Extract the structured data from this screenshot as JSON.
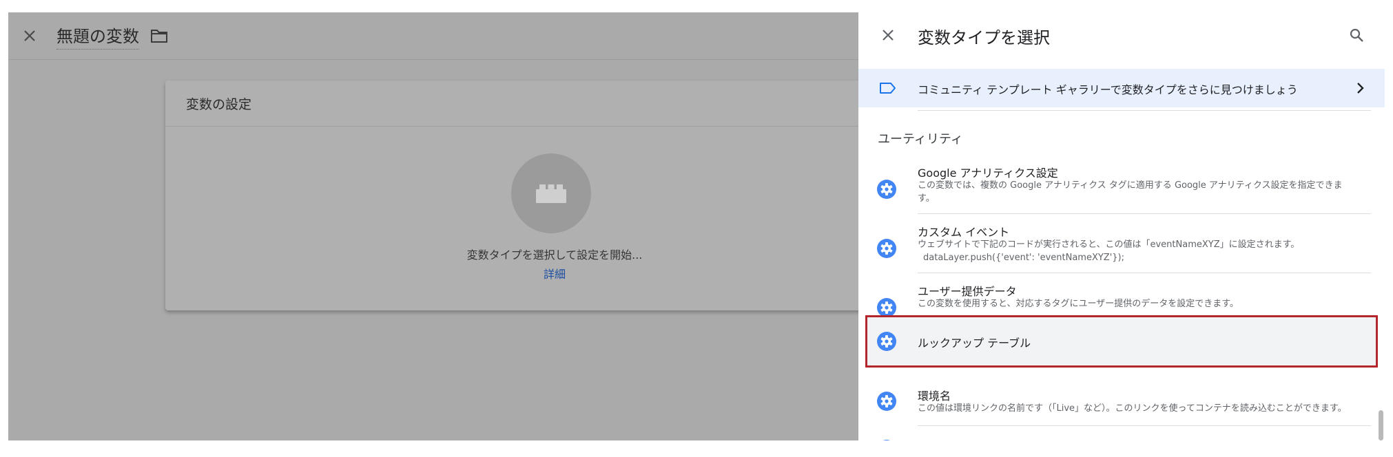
{
  "editor": {
    "title": "無題の変数",
    "card": {
      "title": "変数の設定",
      "hint": "変数タイプを選択して設定を開始...",
      "link": "詳細"
    }
  },
  "panel": {
    "title": "変数タイプを選択",
    "banner_text": "コミュニティ テンプレート ギャラリーで変数タイプをさらに見つけましょう",
    "section_title": "ユーティリティ",
    "items": [
      {
        "name": "Google アナリティクス設定",
        "desc": "この変数では、複数の Google アナリティクス タグに適用する Google アナリティクス設定を指定できます。"
      },
      {
        "name": "カスタム イベント",
        "desc": "ウェブサイトで下記のコードが実行されると、この値は「eventNameXYZ」に設定されます。",
        "code": "dataLayer.push({'event': 'eventNameXYZ'});"
      },
      {
        "name": "ユーザー提供データ",
        "desc": "この変数を使用すると、対応するタグにユーザー提供のデータを設定できます。"
      },
      {
        "name": "ルックアップ テーブル",
        "selected": true
      },
      {
        "name": "環境名",
        "desc": "この値は環境リンクの名前です（「Live」など）。このリンクを使ってコンテナを読み込むことができます。"
      }
    ]
  },
  "colors": {
    "icon_blue": "#4285f4",
    "banner_bg": "#e8f0fe",
    "highlight_border": "#b3262b",
    "overlay_gray": "#aaaaaa"
  },
  "icons": {
    "close": "close-icon",
    "folder": "folder-icon",
    "search": "search-icon",
    "banner": "label-icon",
    "chevron": "chevron-right-icon",
    "item": "gear-icon",
    "placeholder": "brick-icon"
  }
}
